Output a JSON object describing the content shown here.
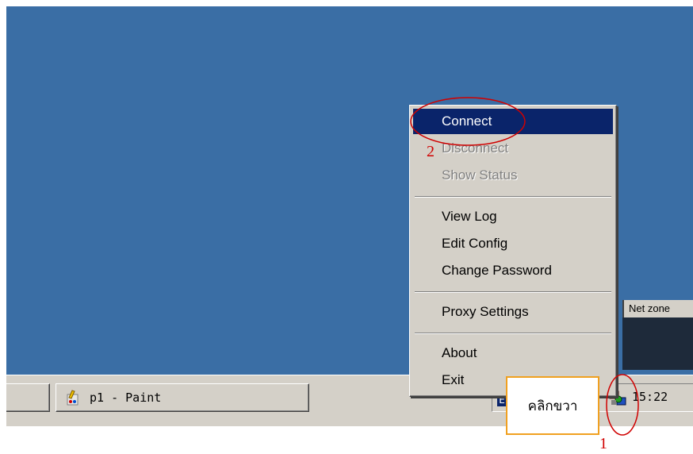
{
  "desktop": {
    "background_color": "#3a6ea5"
  },
  "context_menu": {
    "items": [
      {
        "label": "Connect",
        "state": "selected"
      },
      {
        "label": "Disconnect",
        "state": "disabled"
      },
      {
        "label": "Show Status",
        "state": "disabled"
      },
      {
        "label": "View Log",
        "state": "enabled"
      },
      {
        "label": "Edit Config",
        "state": "enabled"
      },
      {
        "label": "Change Password",
        "state": "enabled"
      },
      {
        "label": "Proxy Settings",
        "state": "enabled"
      },
      {
        "label": "About",
        "state": "enabled"
      },
      {
        "label": "Exit",
        "state": "enabled"
      }
    ]
  },
  "taskbar": {
    "paint_button_label": "p1 - Paint",
    "tray_indicator": "E",
    "clock": "15:22",
    "tray_icon": "network-tray-icon"
  },
  "background_window": {
    "title": "Net zone"
  },
  "annotations": {
    "callout_text": "คลิกขวา",
    "marker_1": "1",
    "marker_2": "2",
    "highlight_color": "#d00000",
    "callout_border_color": "#f0a020"
  }
}
